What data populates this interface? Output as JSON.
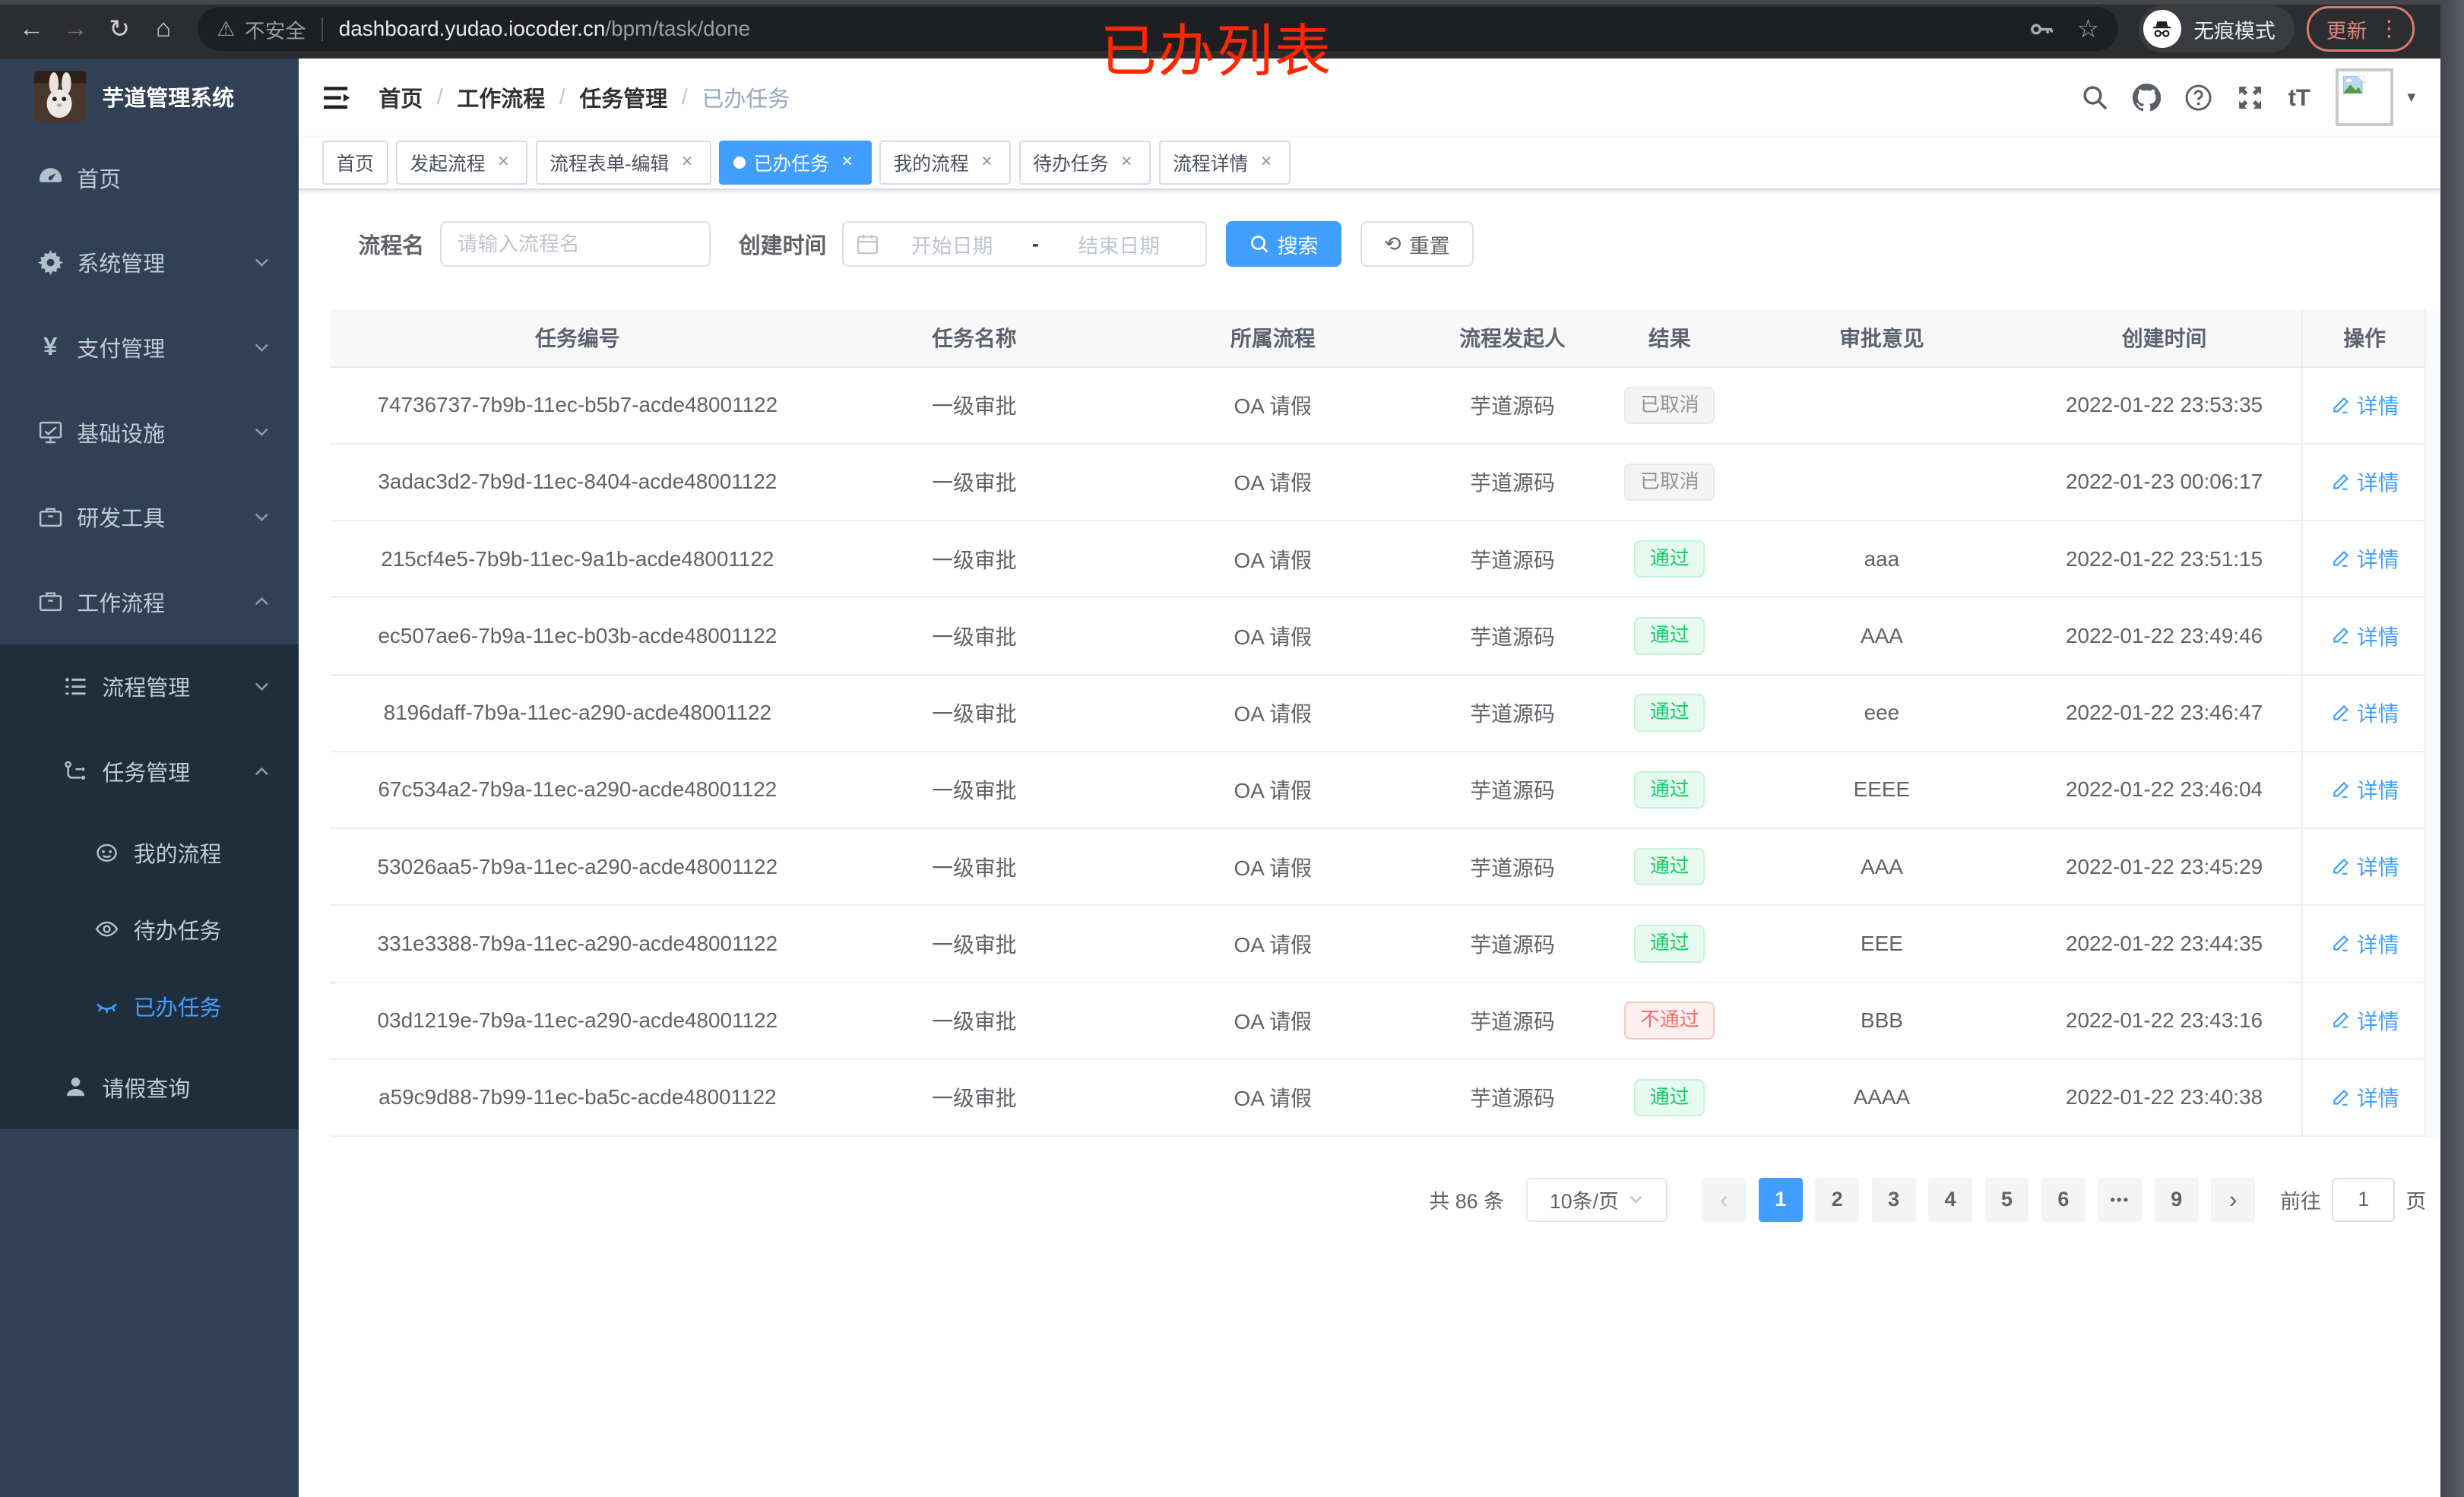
{
  "browser": {
    "security_label": "不安全",
    "url_host": "dashboard.yudao.iocoder.cn",
    "url_path": "/bpm/task/done",
    "incognito_label": "无痕模式",
    "update_label": "更新"
  },
  "annotation": {
    "title": "已办列表"
  },
  "sidebar": {
    "app_title": "芋道管理系统",
    "items": [
      {
        "label": "首页",
        "icon": "dashboard-icon"
      },
      {
        "label": "系统管理",
        "icon": "gear-icon"
      },
      {
        "label": "支付管理",
        "icon": "yen-icon"
      },
      {
        "label": "基础设施",
        "icon": "monitor-icon"
      },
      {
        "label": "研发工具",
        "icon": "briefcase-icon"
      },
      {
        "label": "工作流程",
        "icon": "briefcase-icon",
        "expanded": true
      }
    ],
    "sub": [
      {
        "label": "流程管理",
        "icon": "list-icon"
      },
      {
        "label": "任务管理",
        "icon": "flow-icon",
        "expanded": true
      },
      {
        "label": "我的流程",
        "icon": "face-icon"
      },
      {
        "label": "待办任务",
        "icon": "eye-icon"
      },
      {
        "label": "已办任务",
        "icon": "eye-closed-icon",
        "active": true
      },
      {
        "label": "请假查询",
        "icon": "user-icon"
      }
    ]
  },
  "header": {
    "breadcrumb": [
      "首页",
      "工作流程",
      "任务管理",
      "已办任务"
    ],
    "font_size_icon_text": "tT"
  },
  "tabs": [
    {
      "label": "首页",
      "closable": false
    },
    {
      "label": "发起流程",
      "closable": true
    },
    {
      "label": "流程表单-编辑",
      "closable": true
    },
    {
      "label": "已办任务",
      "closable": true,
      "active": true
    },
    {
      "label": "我的流程",
      "closable": true
    },
    {
      "label": "待办任务",
      "closable": true
    },
    {
      "label": "流程详情",
      "closable": true
    }
  ],
  "filter": {
    "name_label": "流程名",
    "name_placeholder": "请输入流程名",
    "time_label": "创建时间",
    "start_placeholder": "开始日期",
    "range_separator": "-",
    "end_placeholder": "结束日期",
    "search_label": "搜索",
    "reset_label": "重置"
  },
  "table": {
    "columns": [
      "任务编号",
      "任务名称",
      "所属流程",
      "流程发起人",
      "结果",
      "审批意见",
      "创建时间",
      "操作"
    ],
    "action_label": "详情",
    "rows": [
      {
        "id": "74736737-7b9b-11ec-b5b7-acde48001122",
        "name": "一级审批",
        "process": "OA 请假",
        "starter": "芋道源码",
        "result": "已取消",
        "result_type": "info",
        "comment": "",
        "created": "2022-01-22 23:53:35",
        "action": "详情"
      },
      {
        "id": "3adac3d2-7b9d-11ec-8404-acde48001122",
        "name": "一级审批",
        "process": "OA 请假",
        "starter": "芋道源码",
        "result": "已取消",
        "result_type": "info",
        "comment": "",
        "created": "2022-01-23 00:06:17",
        "action": "详情"
      },
      {
        "id": "215cf4e5-7b9b-11ec-9a1b-acde48001122",
        "name": "一级审批",
        "process": "OA 请假",
        "starter": "芋道源码",
        "result": "通过",
        "result_type": "success",
        "comment": "aaa",
        "created": "2022-01-22 23:51:15",
        "action": "详情"
      },
      {
        "id": "ec507ae6-7b9a-11ec-b03b-acde48001122",
        "name": "一级审批",
        "process": "OA 请假",
        "starter": "芋道源码",
        "result": "通过",
        "result_type": "success",
        "comment": "AAA",
        "created": "2022-01-22 23:49:46",
        "action": "详情"
      },
      {
        "id": "8196daff-7b9a-11ec-a290-acde48001122",
        "name": "一级审批",
        "process": "OA 请假",
        "starter": "芋道源码",
        "result": "通过",
        "result_type": "success",
        "comment": "eee",
        "created": "2022-01-22 23:46:47",
        "action": "详情"
      },
      {
        "id": "67c534a2-7b9a-11ec-a290-acde48001122",
        "name": "一级审批",
        "process": "OA 请假",
        "starter": "芋道源码",
        "result": "通过",
        "result_type": "success",
        "comment": "EEEE",
        "created": "2022-01-22 23:46:04",
        "action": "详情"
      },
      {
        "id": "53026aa5-7b9a-11ec-a290-acde48001122",
        "name": "一级审批",
        "process": "OA 请假",
        "starter": "芋道源码",
        "result": "通过",
        "result_type": "success",
        "comment": "AAA",
        "created": "2022-01-22 23:45:29",
        "action": "详情"
      },
      {
        "id": "331e3388-7b9a-11ec-a290-acde48001122",
        "name": "一级审批",
        "process": "OA 请假",
        "starter": "芋道源码",
        "result": "通过",
        "result_type": "success",
        "comment": "EEE",
        "created": "2022-01-22 23:44:35",
        "action": "详情"
      },
      {
        "id": "03d1219e-7b9a-11ec-a290-acde48001122",
        "name": "一级审批",
        "process": "OA 请假",
        "starter": "芋道源码",
        "result": "不通过",
        "result_type": "danger",
        "comment": "BBB",
        "created": "2022-01-22 23:43:16",
        "action": "详情"
      },
      {
        "id": "a59c9d88-7b99-11ec-ba5c-acde48001122",
        "name": "一级审批",
        "process": "OA 请假",
        "starter": "芋道源码",
        "result": "通过",
        "result_type": "success",
        "comment": "AAAA",
        "created": "2022-01-22 23:40:38",
        "action": "详情"
      }
    ]
  },
  "pagination": {
    "total_label": "共 86 条",
    "page_size": "10条/页",
    "prev": "‹",
    "next": "›",
    "pages": [
      "1",
      "2",
      "3",
      "4",
      "5",
      "6"
    ],
    "ellipsis": "•••",
    "last_page": "9",
    "goto_label": "前往",
    "goto_value": "1",
    "page_unit": "页"
  },
  "colors": {
    "accent": "#409eff",
    "sidebar_bg": "#304156",
    "submenu_bg": "#1f2d3d",
    "success": "#13ce66",
    "danger": "#f56c6c",
    "info": "#909399",
    "annotation_red": "#ff2600"
  }
}
